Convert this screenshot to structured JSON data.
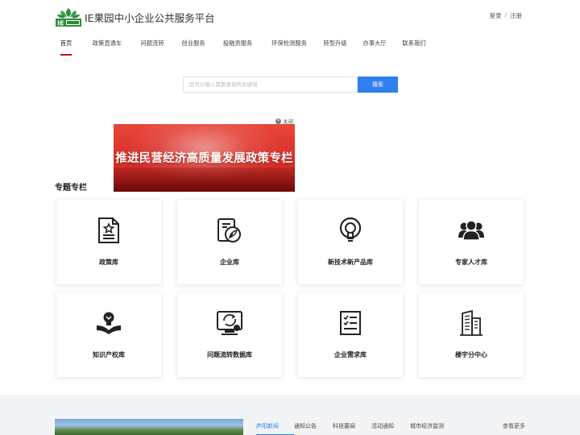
{
  "header": {
    "site_title": "IE果园中小企业公共服务平台",
    "login": "登录",
    "separator": "/",
    "register": "注册"
  },
  "nav": {
    "items": [
      "首页",
      "政策直通车",
      "问题流转",
      "创业服务",
      "投融资服务",
      "环保检测服务",
      "转型升级",
      "办事大厅",
      "联系我们"
    ],
    "active_index": 0
  },
  "search": {
    "placeholder": "您可以输入需要查询的关键词",
    "button_label": "搜索"
  },
  "banner": {
    "close_label": "关闭",
    "text": "推进民营经济高质量发展政策专栏"
  },
  "topics": {
    "title": "专题专栏",
    "cards": [
      {
        "label": "政策库",
        "icon": "document-icon"
      },
      {
        "label": "企业库",
        "icon": "enterprise-icon"
      },
      {
        "label": "新技术新产品库",
        "icon": "lightbulb-icon"
      },
      {
        "label": "专家人才库",
        "icon": "people-icon"
      },
      {
        "label": "知识产权库",
        "icon": "ip-icon"
      },
      {
        "label": "问题流转数据库",
        "icon": "monitor-cycle-icon"
      },
      {
        "label": "企业需求库",
        "icon": "checklist-icon"
      },
      {
        "label": "楼宇分中心",
        "icon": "building-icon"
      }
    ]
  },
  "news": {
    "tabs": [
      "庐阳新闻",
      "通知公告",
      "科技要闻",
      "活动通知",
      "城市经济监测"
    ],
    "active_tab": 0,
    "more_label": "查看更多"
  },
  "colors": {
    "accent_blue": "#2f7ff0",
    "nav_active_red": "#d0021b",
    "banner_red": "#d9322b",
    "logo_green": "#2e8b3a"
  }
}
